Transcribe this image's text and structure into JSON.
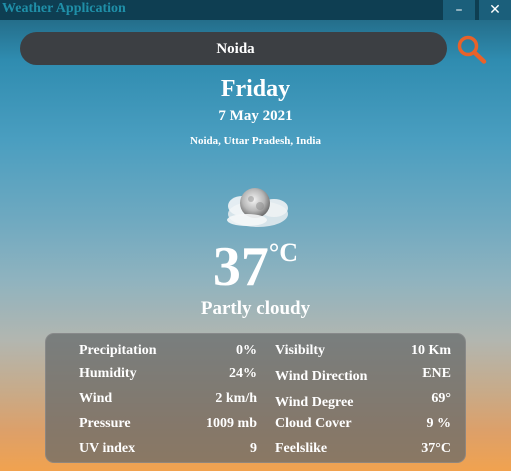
{
  "window": {
    "title": "Weather Application",
    "minimize_glyph": "–",
    "close_glyph": "✕"
  },
  "search": {
    "value": "Noida",
    "icon": "search-icon",
    "accent_color": "#e8622a"
  },
  "header": {
    "day": "Friday",
    "date": "7 May 2021",
    "location": "Noida, Uttar Pradesh, India"
  },
  "current": {
    "icon": "partly-cloudy-icon",
    "temperature": "37",
    "unit": "°C",
    "condition": "Partly cloudy"
  },
  "details": {
    "left": [
      {
        "label": "Precipitation",
        "value": "0%"
      },
      {
        "label": "Humidity",
        "value": "24%"
      },
      {
        "label": "Wind",
        "value": "2 km/h"
      },
      {
        "label": "Pressure",
        "value": "1009 mb"
      },
      {
        "label": "UV index",
        "value": "9"
      }
    ],
    "right": [
      {
        "label": "Visibilty",
        "value": "10 Km"
      },
      {
        "label": "Wind Direction",
        "value": "ENE"
      },
      {
        "label": "Wind Degree",
        "value": "69°"
      },
      {
        "label": "Cloud Cover",
        "value": "9 %"
      },
      {
        "label": "Feelslike",
        "value": "37°C"
      }
    ]
  }
}
